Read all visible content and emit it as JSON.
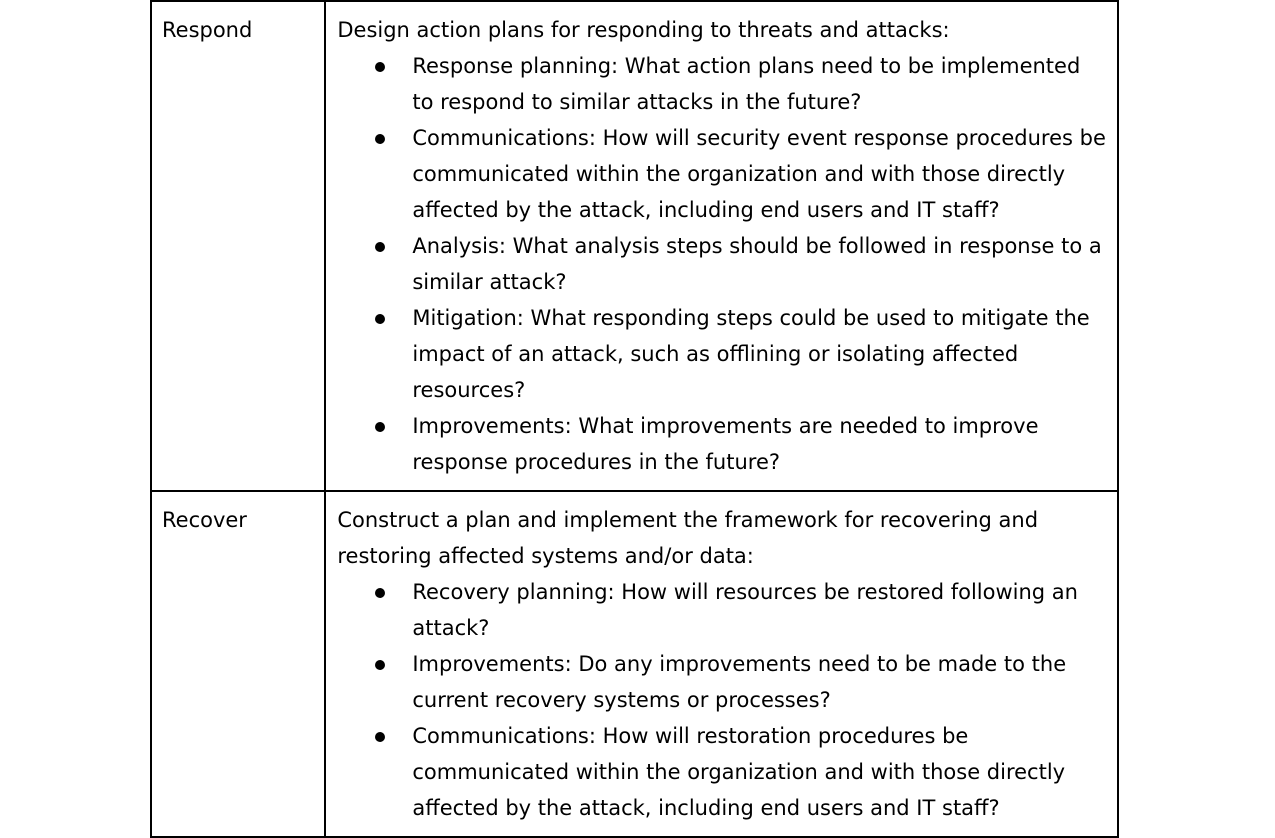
{
  "rows": [
    {
      "label": "Respond",
      "intro": "Design action plans for responding to threats and attacks:",
      "items": [
        "Response planning: What action plans need to be implemented to respond to similar attacks in the future?",
        "Communications: How will security event response procedures be communicated within the organization and with those directly affected by the attack, including end users and IT staff?",
        "Analysis: What analysis steps should be followed in response to a similar attack?",
        "Mitigation: What responding steps could be used to mitigate the impact of an attack, such as offlining or isolating affected resources?",
        "Improvements: What improvements are needed to improve response procedures in the future?"
      ]
    },
    {
      "label": "Recover",
      "intro": "Construct a plan and implement the framework for recovering and restoring affected systems and/or data:",
      "items": [
        "Recovery planning: How will resources be restored following an attack?",
        "Improvements: Do any improvements need to be made to the current recovery systems or processes?",
        "Communications: How will restoration procedures be communicated within the organization and with those directly affected by the attack, including end users and IT staff?"
      ]
    }
  ]
}
